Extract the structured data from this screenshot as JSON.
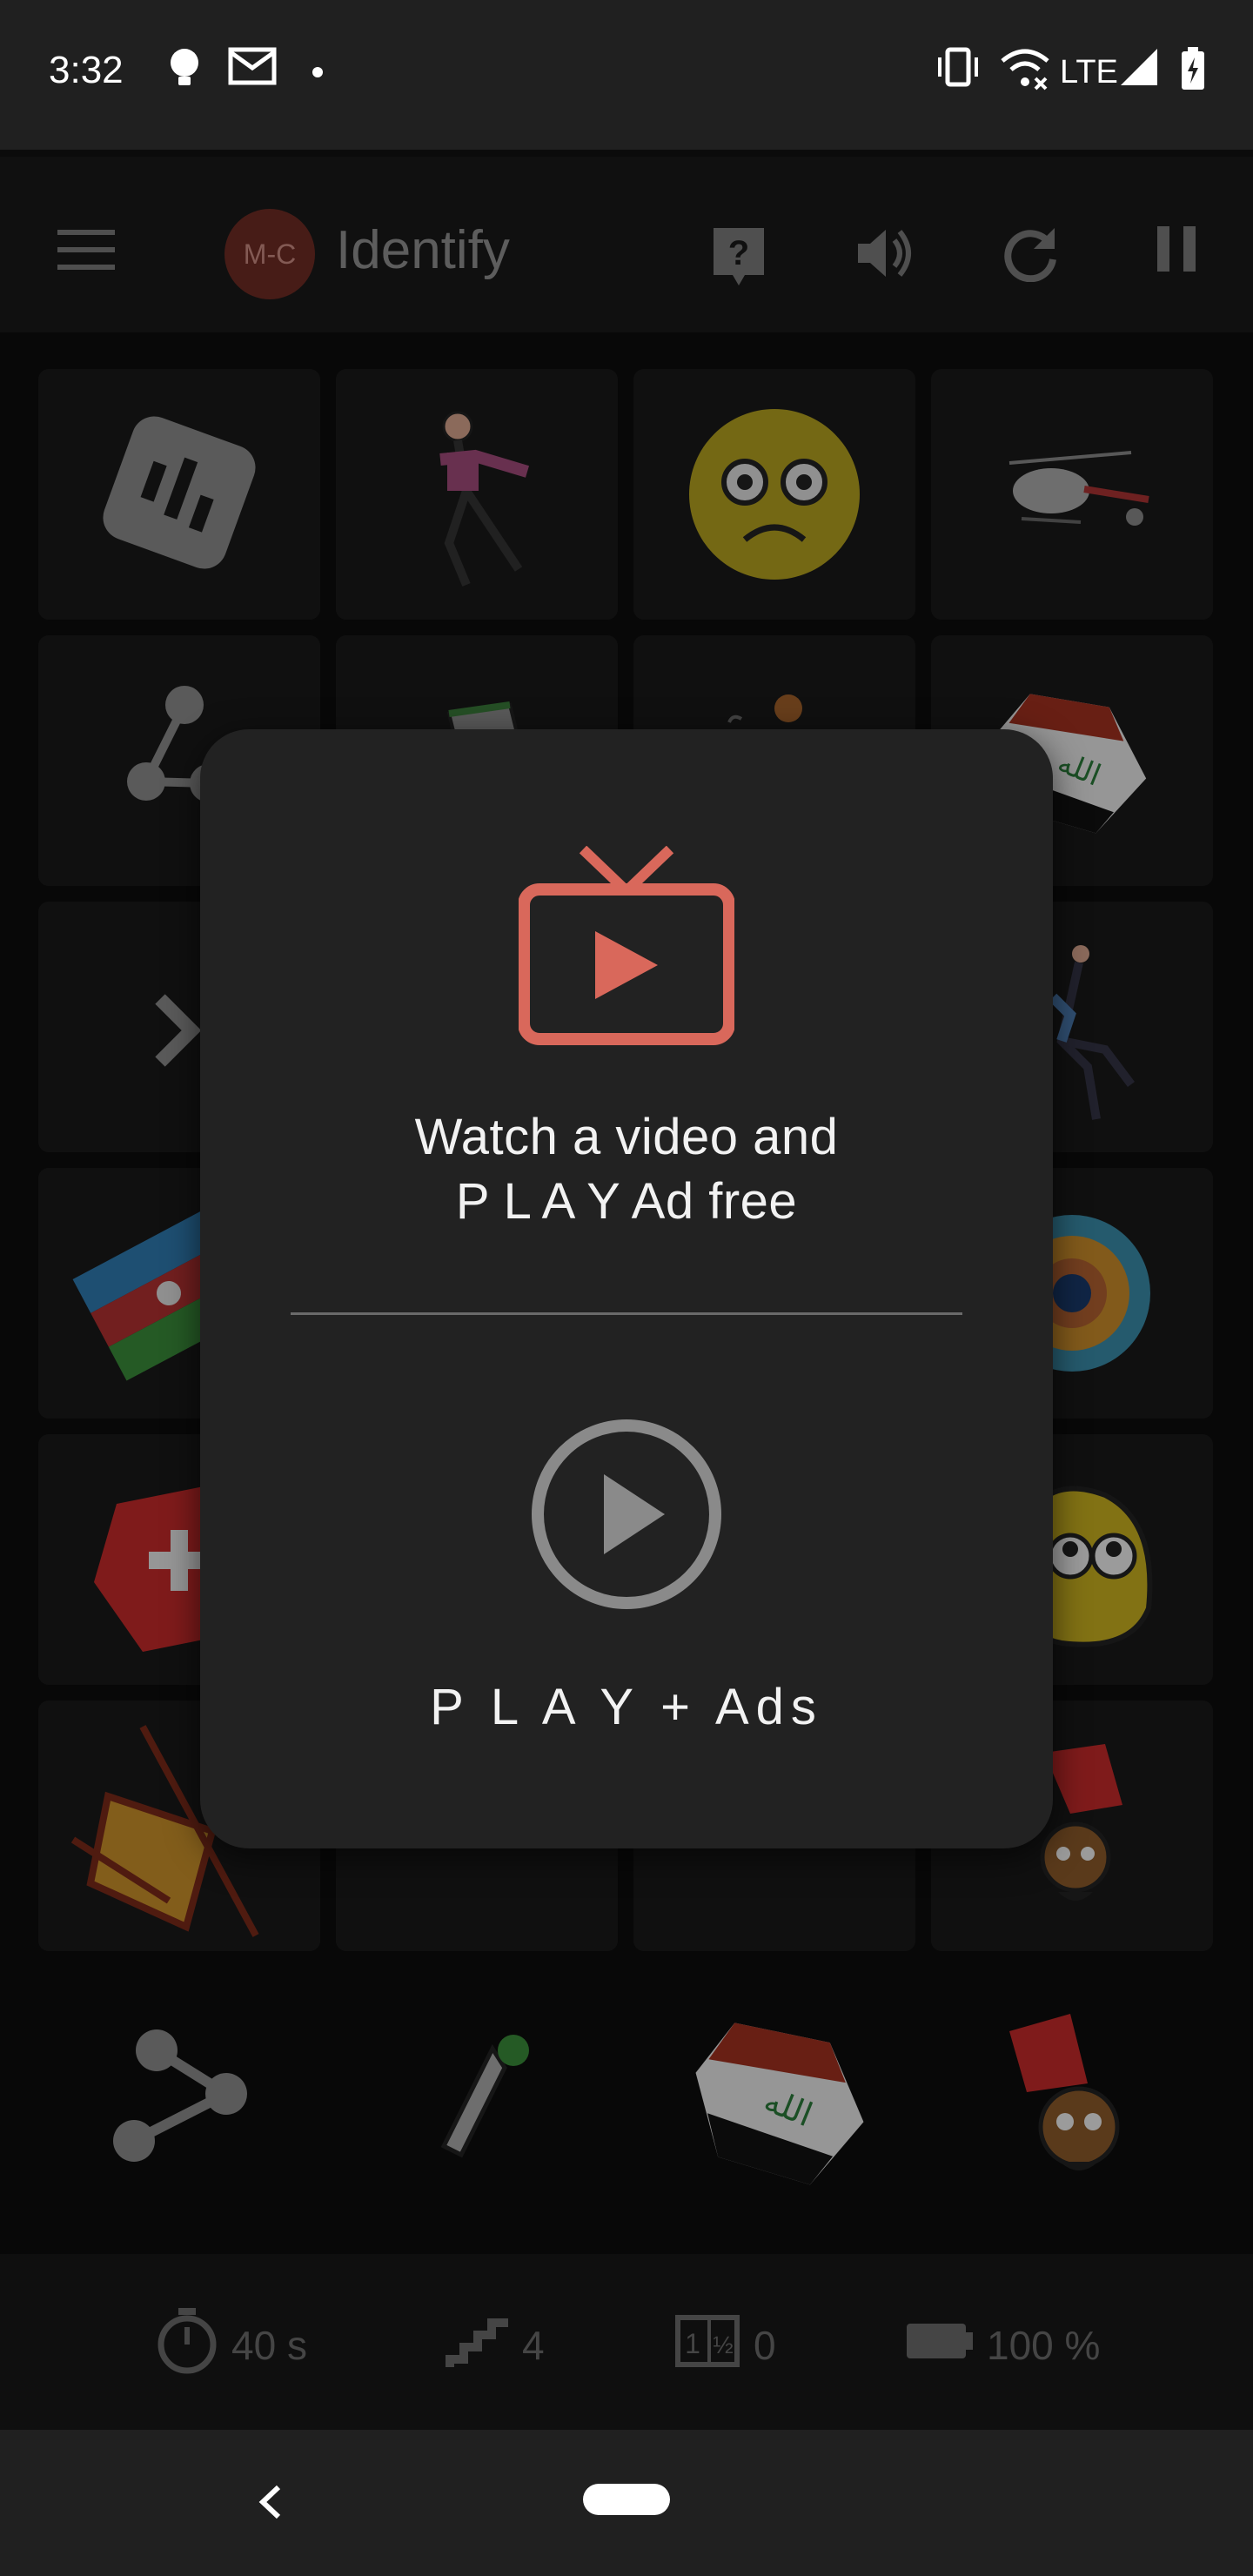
{
  "status_bar": {
    "time": "3:32",
    "icons": [
      "lightbulb-icon",
      "gmail-icon",
      "dot-icon",
      "vibrate-icon",
      "wifi-off-icon",
      "signal-icon",
      "battery-charging-icon"
    ],
    "network": "LTE"
  },
  "app_bar": {
    "logo_text": "M-C",
    "title": "Identify",
    "actions": [
      "help-icon",
      "volume-icon",
      "refresh-icon",
      "pause-icon"
    ]
  },
  "grid": {
    "tiles": [
      "report-icon",
      "dancer-figure",
      "worried-emoji",
      "helicopter",
      "share-icon",
      "flowerpot",
      "figure",
      "iraq-flag",
      "chevron-right-icon",
      "",
      "",
      "falling-figure",
      "azerbaijan-flag",
      "",
      "",
      "flower",
      "swiss-flag",
      "",
      "",
      "chick-emoji",
      "deck-chair",
      "",
      "",
      "character"
    ]
  },
  "tray": {
    "items": [
      "share-icon",
      "duck-figure",
      "iraq-flag",
      "character"
    ]
  },
  "stats": {
    "timer": "40 s",
    "steps": "4",
    "score": "0",
    "battery": "100 %"
  },
  "dialog": {
    "watch_text": "Watch a video and\nP L A Y  Ad free",
    "play_ads_text": "P L A Y + Ads"
  },
  "colors": {
    "accent": "#d9685b",
    "grey_icon": "#8a8a8a",
    "dialog_bg": "#222222"
  }
}
